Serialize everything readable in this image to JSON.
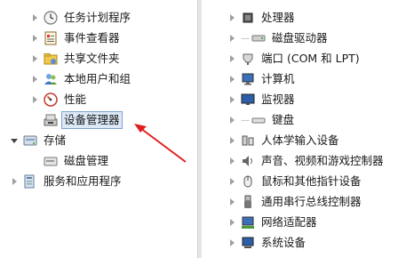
{
  "left_tree": {
    "items": [
      {
        "label": "任务计划程序",
        "icon": "clock-icon"
      },
      {
        "label": "事件查看器",
        "icon": "event-viewer-icon"
      },
      {
        "label": "共享文件夹",
        "icon": "shared-folder-icon"
      },
      {
        "label": "本地用户和组",
        "icon": "users-icon"
      },
      {
        "label": "性能",
        "icon": "performance-icon"
      },
      {
        "label": "设备管理器",
        "icon": "device-manager-icon"
      },
      {
        "label": "存储",
        "icon": "storage-icon"
      },
      {
        "label": "磁盘管理",
        "icon": "disk-management-icon"
      },
      {
        "label": "服务和应用程序",
        "icon": "services-icon"
      }
    ]
  },
  "right_tree": {
    "items": [
      {
        "label": "处理器",
        "icon": "processor-icon"
      },
      {
        "label": "磁盘驱动器",
        "icon": "disk-drive-icon"
      },
      {
        "label": "端口 (COM 和 LPT)",
        "icon": "port-icon"
      },
      {
        "label": "计算机",
        "icon": "computer-icon"
      },
      {
        "label": "监视器",
        "icon": "monitor-icon"
      },
      {
        "label": "键盘",
        "icon": "keyboard-icon"
      },
      {
        "label": "人体学输入设备",
        "icon": "hid-icon"
      },
      {
        "label": "声音、视频和游戏控制器",
        "icon": "speaker-icon"
      },
      {
        "label": "鼠标和其他指针设备",
        "icon": "mouse-icon"
      },
      {
        "label": "通用串行总线控制器",
        "icon": "usb-icon"
      },
      {
        "label": "网络适配器",
        "icon": "network-adapter-icon"
      },
      {
        "label": "系统设备",
        "icon": "system-devices-icon"
      }
    ]
  },
  "annotation": {
    "arrow_color": "#e02020"
  }
}
